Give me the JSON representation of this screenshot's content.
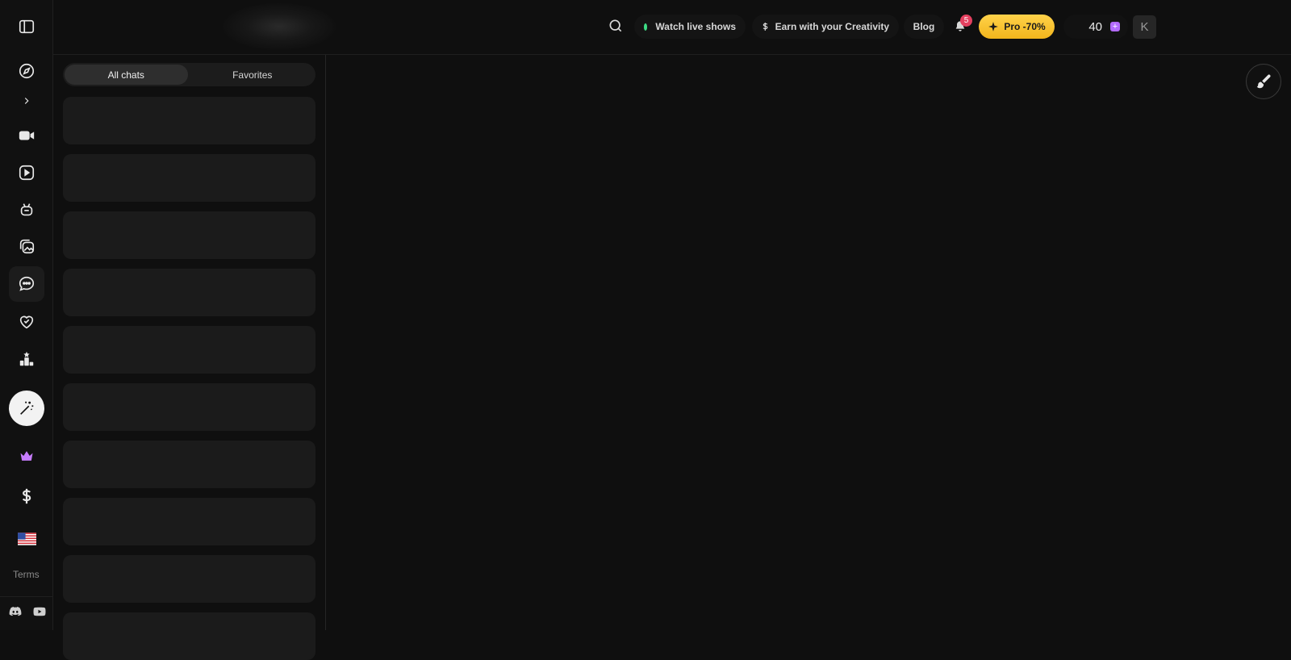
{
  "header": {
    "watch_live_label": "Watch live shows",
    "earn_label": "Earn with your Creativity",
    "blog_label": "Blog",
    "notification_count": "5",
    "pro_label": "Pro -70%",
    "credits": "40",
    "avatar_initial": "K"
  },
  "tabs": [
    "All chats",
    "Favorites"
  ],
  "rail": {
    "terms_label": "Terms"
  },
  "colors": {
    "background": "#0f0f0f",
    "accent_pro": "#f2b51c",
    "live_dot": "#3ddc84",
    "notification_badge": "#e4405f",
    "credits_plus": "#b36bff"
  },
  "chat_list": {
    "loading_placeholder_count": 10
  }
}
